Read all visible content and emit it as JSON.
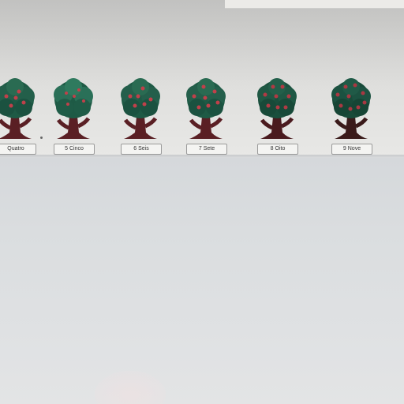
{
  "trees": [
    {
      "label": "Quatro",
      "icon": "apple-tree-icon"
    },
    {
      "label": "5 Cinco",
      "icon": "apple-tree-icon"
    },
    {
      "label": "6 Seis",
      "icon": "apple-tree-icon"
    },
    {
      "label": "7 Sete",
      "icon": "apple-tree-icon"
    },
    {
      "label": "8 Oito",
      "icon": "apple-tree-icon"
    },
    {
      "label": "9 Nove",
      "icon": "apple-tree-icon"
    }
  ],
  "colors": {
    "foliage": "#1e5a45",
    "foliage_highlight": "#2f7a5e",
    "trunk": "#5a1f24",
    "apple": "#c0404a",
    "wall": "#dcdcda",
    "board": "#dadddf"
  }
}
